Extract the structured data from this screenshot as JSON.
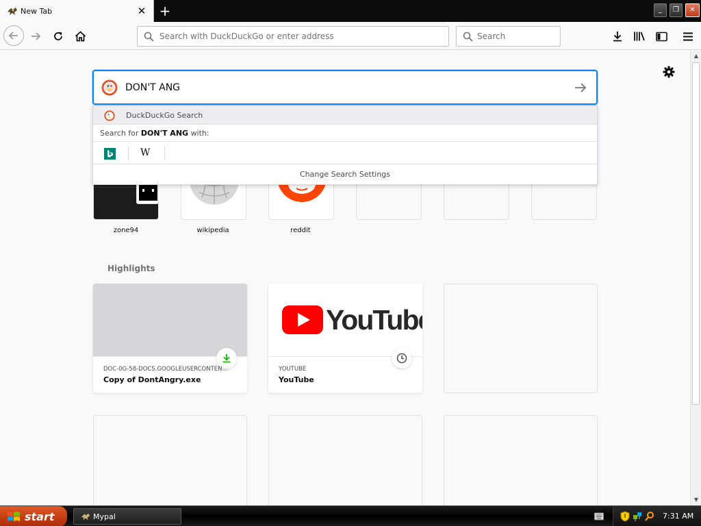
{
  "browser": {
    "tab": {
      "title": "New Tab",
      "close_glyph": "✕"
    },
    "new_tab_glyph": "+",
    "window_controls": {
      "minimize": "_",
      "maximize": "❐",
      "close": "✕"
    },
    "urlbar": {
      "placeholder": "Search with DuckDuckGo or enter address",
      "value": ""
    },
    "searchbar": {
      "placeholder": "Search",
      "value": ""
    }
  },
  "newtab": {
    "search": {
      "query": "DON'T ANG",
      "suggestion": "DuckDuckGo Search",
      "search_for_prefix": "Search for",
      "search_for_term": "DON'T ANG",
      "search_for_suffix": "with:",
      "engines": [
        "bing-icon",
        "wikipedia-icon"
      ],
      "wiki_glyph": "W",
      "change_settings": "Change Search Settings"
    },
    "top_sites": [
      {
        "label": "zone94"
      },
      {
        "label": "wikipedia"
      },
      {
        "label": "reddit"
      }
    ],
    "highlights": {
      "title": "Highlights",
      "cards": [
        {
          "host": "DOC-0G-58-DOCS.GOOGLEUSERCONTEN...",
          "name": "Copy of DontAngry.exe",
          "badge": "download-icon"
        },
        {
          "host": "YOUTUBE",
          "name": "YouTube",
          "badge": "clock-icon",
          "logo_text": "YouTube"
        }
      ]
    }
  },
  "taskbar": {
    "start_label": "start",
    "task_label": "Mypal",
    "clock": "7:31 AM"
  },
  "colors": {
    "accent": "#0a84ff",
    "youtube_red": "#ff0000",
    "reddit_orange": "#ff4500",
    "bing_teal": "#008373",
    "download_green": "#12bc00"
  }
}
